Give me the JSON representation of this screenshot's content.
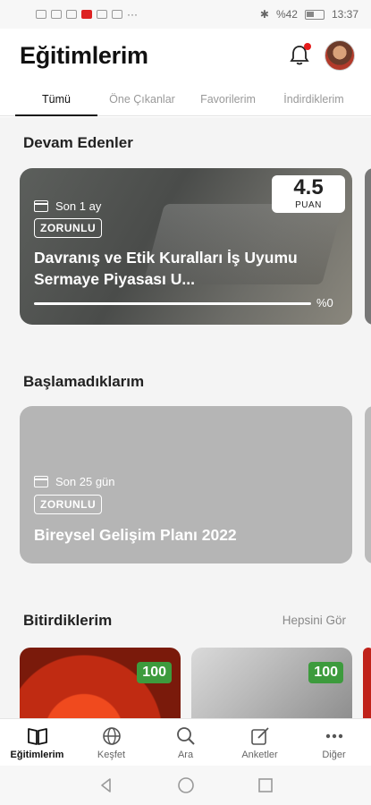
{
  "status_bar": {
    "battery_text": "%42",
    "time": "13:37"
  },
  "header": {
    "title": "Eğitimlerim"
  },
  "tabs": [
    {
      "label": "Tümü"
    },
    {
      "label": "Öne Çıkanlar"
    },
    {
      "label": "Favorilerim"
    },
    {
      "label": "İndirdiklerim"
    }
  ],
  "in_progress": {
    "title": "Devam Edenler",
    "card": {
      "time_label": "Son 1 ay",
      "badge": "ZORUNLU",
      "title": "Davranış ve Etik Kuralları İş Uyumu Sermaye Piyasası U...",
      "rating_value": "4.5",
      "rating_label": "PUAN",
      "progress_text": "%0",
      "progress_fraction": 0
    }
  },
  "not_started": {
    "title": "Başlamadıklarım",
    "card": {
      "time_label": "Son 25 gün",
      "badge": "ZORUNLU",
      "title": "Bireysel Gelişim Planı 2022"
    }
  },
  "finished": {
    "title": "Bitirdiklerim",
    "see_all": "Hepsini Gör",
    "cards": [
      {
        "score": "100"
      },
      {
        "score": "100"
      }
    ]
  },
  "bottom_nav": [
    {
      "label": "Eğitimlerim",
      "icon": "book-icon"
    },
    {
      "label": "Keşfet",
      "icon": "globe-icon"
    },
    {
      "label": "Ara",
      "icon": "search-icon"
    },
    {
      "label": "Anketler",
      "icon": "edit-icon"
    },
    {
      "label": "Diğer",
      "icon": "more-icon"
    }
  ],
  "colors": {
    "accent": "#e51b1b",
    "success": "#3d9b3d"
  }
}
